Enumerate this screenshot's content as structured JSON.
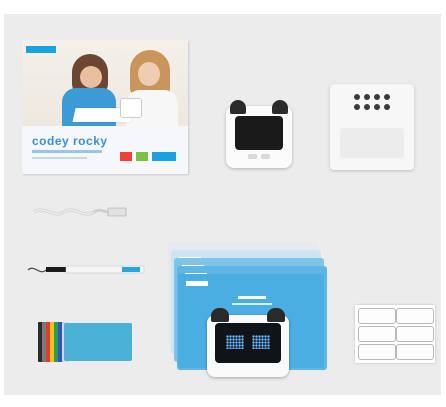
{
  "photo": {
    "box": {
      "title": "codey rocky",
      "brand_color": "#1aa2e0",
      "tag_colors": [
        "#ef4136",
        "#7cc242",
        "#1aa2e0"
      ]
    },
    "robot": {
      "ear_color": "#2a2a2a",
      "eye_color": "#69b9ff"
    },
    "strip_colors": [
      "#2b2b2b",
      "#7a7a7a",
      "#e33b2e",
      "#f4c21e",
      "#2f9e49",
      "#2d58c4",
      "#d8d8d8"
    ],
    "card_color": "#4ab0d6",
    "card_stack_colors": [
      "#e8e9ee",
      "#cde4f2",
      "#7ec4e8",
      "#5fb5e3",
      "#4aaee2"
    ]
  }
}
